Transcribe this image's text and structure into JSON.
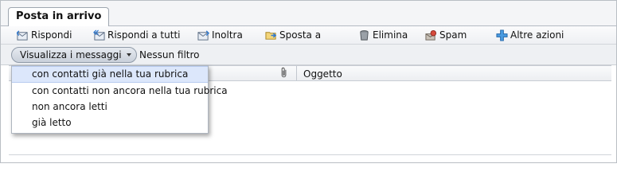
{
  "tab": {
    "label": "Posta in arrivo"
  },
  "toolbar": {
    "reply": "Rispondi",
    "reply_all": "Rispondi a tutti",
    "forward": "Inoltra",
    "move": "Sposta a",
    "delete": "Elimina",
    "spam": "Spam",
    "more": "Altre azioni"
  },
  "filter": {
    "view_label": "Visualizza i messaggi",
    "status": "Nessun filtro"
  },
  "grid": {
    "col_subject": "Oggetto"
  },
  "menu": {
    "items": [
      {
        "label": "con contatti già nella tua rubrica"
      },
      {
        "label": "con contatti non ancora nella tua rubrica"
      },
      {
        "label": "non ancora letti"
      },
      {
        "label": "già letto"
      }
    ]
  }
}
